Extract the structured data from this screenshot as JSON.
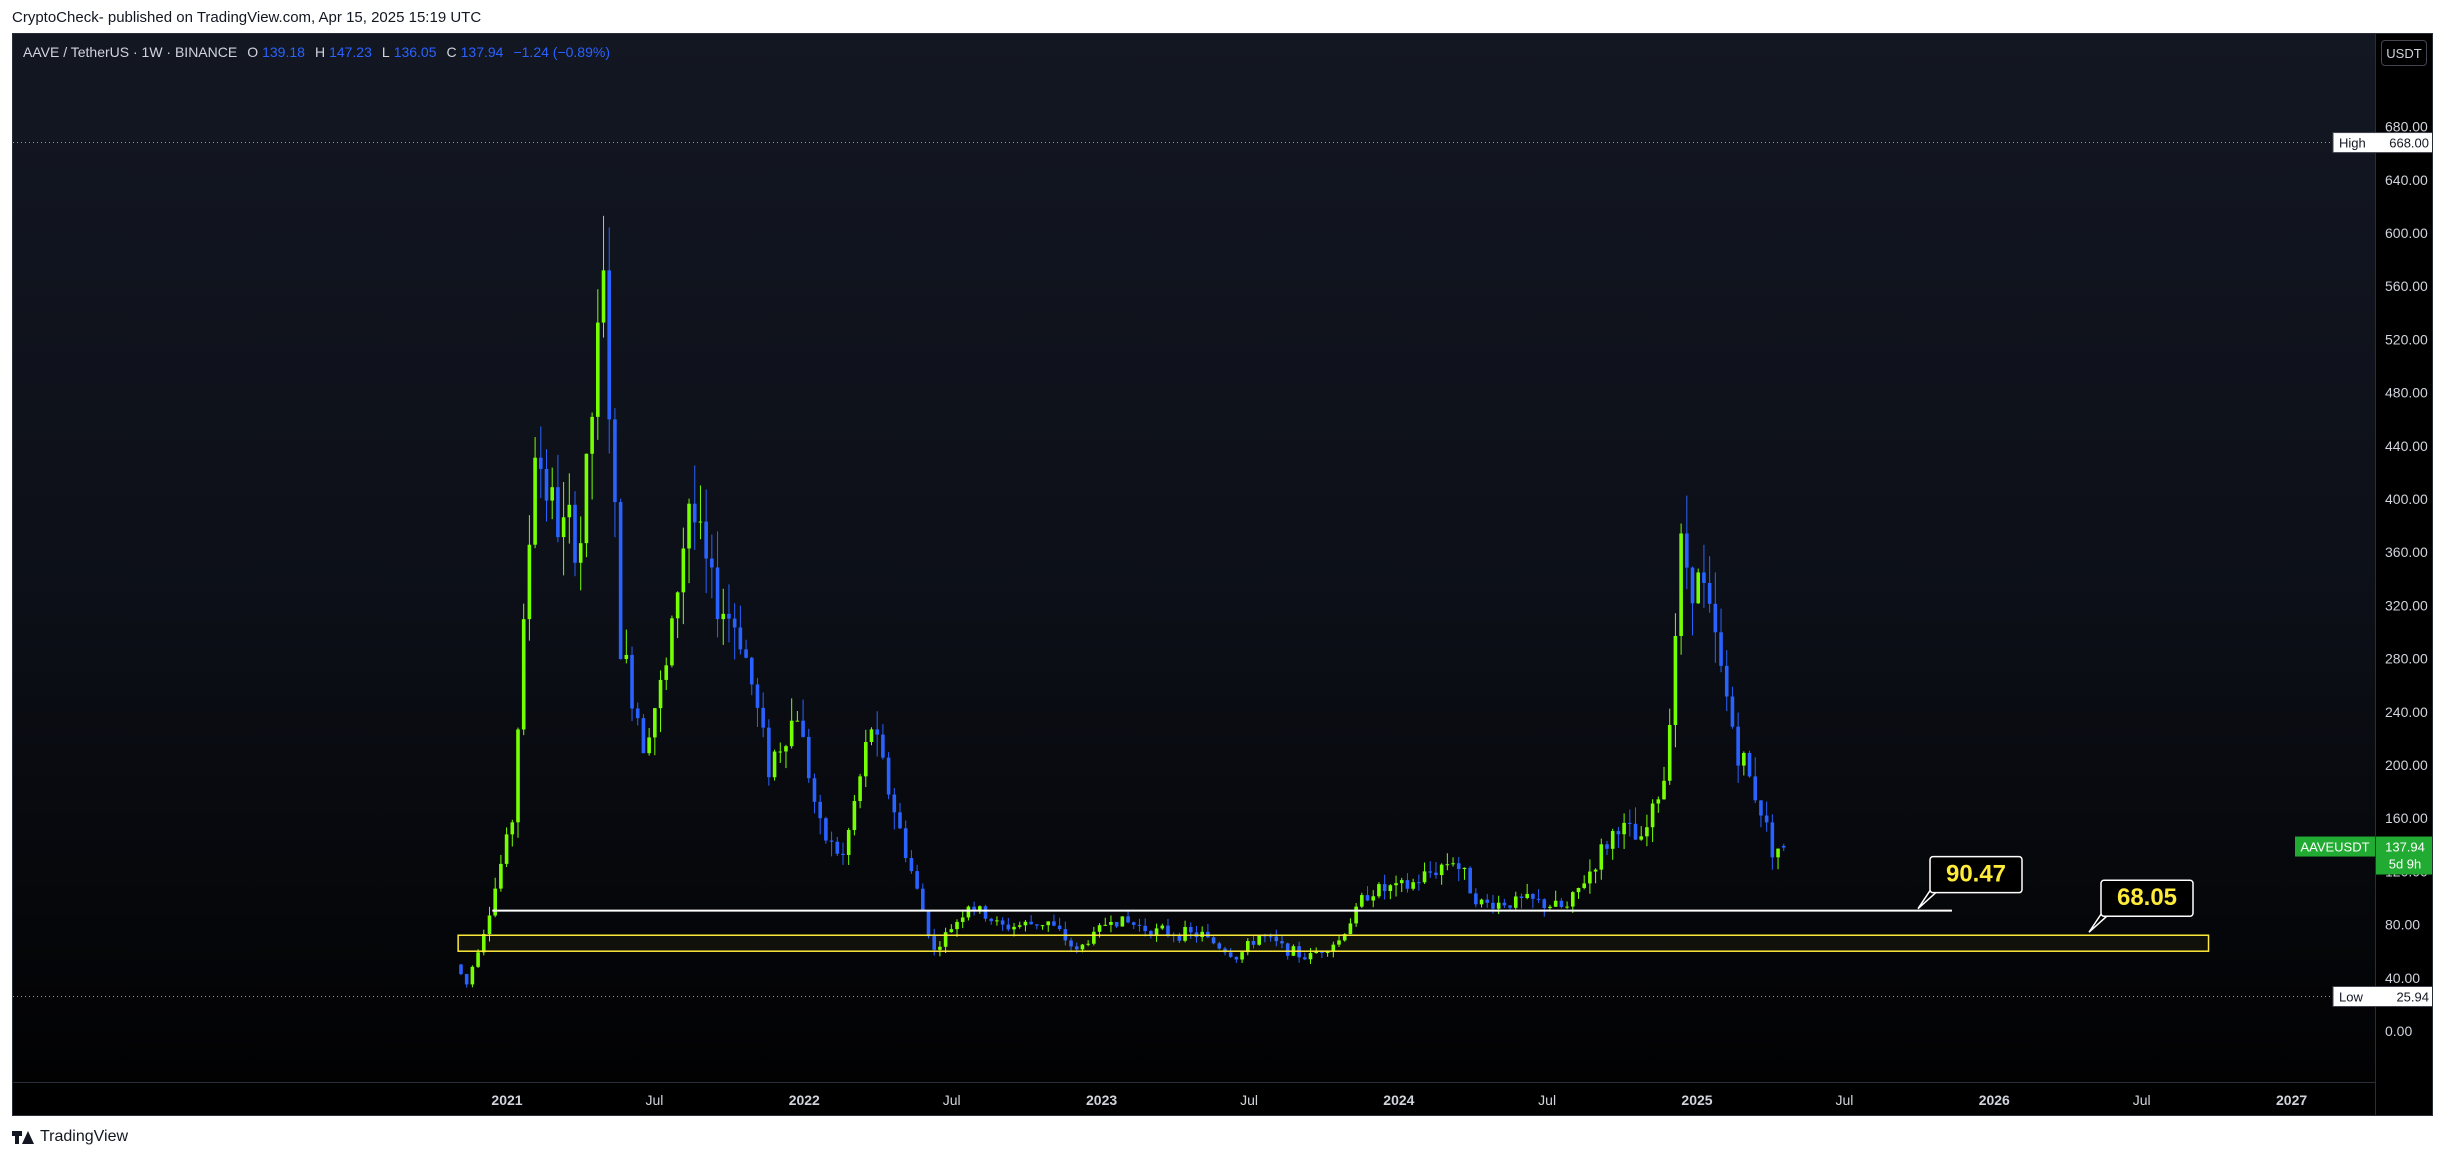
{
  "header": {
    "published_line": "CryptoCheck- published on TradingView.com, Apr 15, 2025 15:19 UTC"
  },
  "legend": {
    "symbol_line": "AAVE / TetherUS · 1W · BINANCE",
    "o_label": "O",
    "o_value": "139.18",
    "h_label": "H",
    "h_value": "147.23",
    "l_label": "L",
    "l_value": "136.05",
    "c_label": "C",
    "c_value": "137.94",
    "change": "−1.24 (−0.89%)"
  },
  "currency_button": "USDT",
  "footer": {
    "brand": "TradingView"
  },
  "colors": {
    "up": "#76ff03",
    "down": "#2962ff",
    "price_tag": "#22ab32",
    "zone_border": "#ffeb3b",
    "callout_text": "#ffeb3b"
  },
  "chart_data": {
    "type": "candlestick",
    "symbol": "AAVEUSDT",
    "timeframe": "1W",
    "ylim": [
      -10,
      700
    ],
    "y_ticks": [
      "0.00",
      "40.00",
      "80.00",
      "120.00",
      "160.00",
      "200.00",
      "240.00",
      "280.00",
      "320.00",
      "360.00",
      "400.00",
      "440.00",
      "480.00",
      "520.00",
      "560.00",
      "600.00",
      "640.00",
      "680.00"
    ],
    "x_ticks": [
      "2021",
      "Jul",
      "2022",
      "Jul",
      "2023",
      "Jul",
      "2024",
      "Jul",
      "2025",
      "Jul",
      "2026",
      "Jul",
      "2027"
    ],
    "high": {
      "label": "High",
      "value": "668.00"
    },
    "low": {
      "label": "Low",
      "value": "25.94"
    },
    "last_price": {
      "symbol": "AAVEUSDT",
      "value": "137.94",
      "countdown": "5d 9h"
    },
    "annotations": [
      {
        "type": "horizontal_line",
        "from_date": "2020-12-14",
        "to_date": "2025-11-10",
        "price": 90.47,
        "label": "90.47"
      },
      {
        "type": "zone",
        "from_date": "2020-11-02",
        "to_date": "2026-09-21",
        "price_low": 60,
        "price_high": 72,
        "label": "68.05"
      }
    ],
    "anchors": [
      {
        "date": "2020-11-02",
        "price": 50
      },
      {
        "date": "2020-11-16",
        "price": 35
      },
      {
        "date": "2020-12-14",
        "price": 90
      },
      {
        "date": "2021-01-11",
        "price": 160
      },
      {
        "date": "2021-02-08",
        "price": 440
      },
      {
        "date": "2021-03-08",
        "price": 380
      },
      {
        "date": "2021-04-05",
        "price": 370
      },
      {
        "date": "2021-05-03",
        "price": 560
      },
      {
        "date": "2021-05-24",
        "price": 290
      },
      {
        "date": "2021-06-21",
        "price": 220
      },
      {
        "date": "2021-07-19",
        "price": 270
      },
      {
        "date": "2021-08-16",
        "price": 400
      },
      {
        "date": "2021-09-13",
        "price": 330
      },
      {
        "date": "2021-10-18",
        "price": 300
      },
      {
        "date": "2021-11-22",
        "price": 200
      },
      {
        "date": "2021-12-27",
        "price": 240
      },
      {
        "date": "2022-01-24",
        "price": 150
      },
      {
        "date": "2022-02-21",
        "price": 130
      },
      {
        "date": "2022-03-28",
        "price": 230
      },
      {
        "date": "2022-05-02",
        "price": 150
      },
      {
        "date": "2022-06-13",
        "price": 60
      },
      {
        "date": "2022-07-25",
        "price": 95
      },
      {
        "date": "2022-09-05",
        "price": 78
      },
      {
        "date": "2022-10-31",
        "price": 82
      },
      {
        "date": "2022-12-05",
        "price": 60
      },
      {
        "date": "2023-01-16",
        "price": 85
      },
      {
        "date": "2023-03-13",
        "price": 75
      },
      {
        "date": "2023-05-08",
        "price": 72
      },
      {
        "date": "2023-06-19",
        "price": 55
      },
      {
        "date": "2023-07-17",
        "price": 72
      },
      {
        "date": "2023-09-11",
        "price": 55
      },
      {
        "date": "2023-10-23",
        "price": 68
      },
      {
        "date": "2023-11-27",
        "price": 105
      },
      {
        "date": "2024-01-15",
        "price": 108
      },
      {
        "date": "2024-03-11",
        "price": 130
      },
      {
        "date": "2024-04-15",
        "price": 95
      },
      {
        "date": "2024-06-10",
        "price": 98
      },
      {
        "date": "2024-07-29",
        "price": 92
      },
      {
        "date": "2024-08-26",
        "price": 120
      },
      {
        "date": "2024-09-30",
        "price": 155
      },
      {
        "date": "2024-10-28",
        "price": 140
      },
      {
        "date": "2024-11-25",
        "price": 190
      },
      {
        "date": "2024-12-16",
        "price": 360
      },
      {
        "date": "2025-01-13",
        "price": 330
      },
      {
        "date": "2025-02-03",
        "price": 270
      },
      {
        "date": "2025-02-24",
        "price": 210
      },
      {
        "date": "2025-03-17",
        "price": 180
      },
      {
        "date": "2025-04-07",
        "price": 139.18
      },
      {
        "date": "2025-04-14",
        "price": 137.94
      }
    ]
  }
}
